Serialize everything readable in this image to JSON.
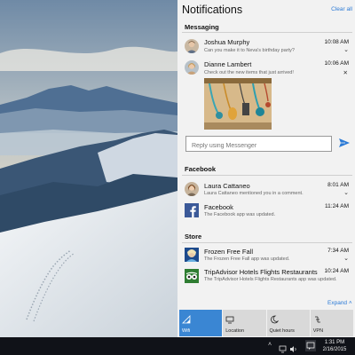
{
  "action_center": {
    "title": "Notifications",
    "clear_all": "Clear all",
    "expand": "Expand ˄"
  },
  "messaging": {
    "label": "Messaging",
    "notes": [
      {
        "sender": "Joshua Murphy",
        "preview": "Can you make it to Neva's birthday party?",
        "time": "10:08 AM"
      },
      {
        "sender": "Dianne Lambert",
        "preview": "Check out the new items that just arrived!",
        "time": "10:06 AM"
      }
    ],
    "reply_placeholder": "Reply using Messenger"
  },
  "facebook": {
    "label": "Facebook",
    "notes": [
      {
        "sender": "Laura Cattaneo",
        "preview": "Laura Cattaneo mentioned you in a comment.",
        "time": "8:01 AM"
      },
      {
        "sender": "Facebook",
        "preview": "The Facebook app was updated.",
        "time": "11:24 AM"
      }
    ]
  },
  "store": {
    "label": "Store",
    "notes": [
      {
        "sender": "Frozen Free Fall",
        "preview": "The Frozen Free Fall app was updated.",
        "time": "7:34 AM"
      },
      {
        "sender": "TripAdvisor Hotels Flights Restaurants",
        "preview": "The TripAdvisor Hotels Flights Restaurants app was updated.",
        "time": "10:24 AM"
      }
    ]
  },
  "quick_actions": [
    {
      "label": "Wifi",
      "icon": "wifi-icon",
      "on": true
    },
    {
      "label": "Location",
      "icon": "location-icon",
      "on": false
    },
    {
      "label": "Quiet hours",
      "icon": "moon-icon",
      "on": false
    },
    {
      "label": "VPN",
      "icon": "vpn-icon",
      "on": false
    }
  ],
  "taskbar": {
    "time": "1:31 PM",
    "date": "2/16/2015",
    "tray_chevron": "˄"
  },
  "colors": {
    "accent": "#2b7ad6",
    "tile_on": "#3a86d3",
    "panel": "#f2f2f2",
    "taskbar": "#101218"
  }
}
